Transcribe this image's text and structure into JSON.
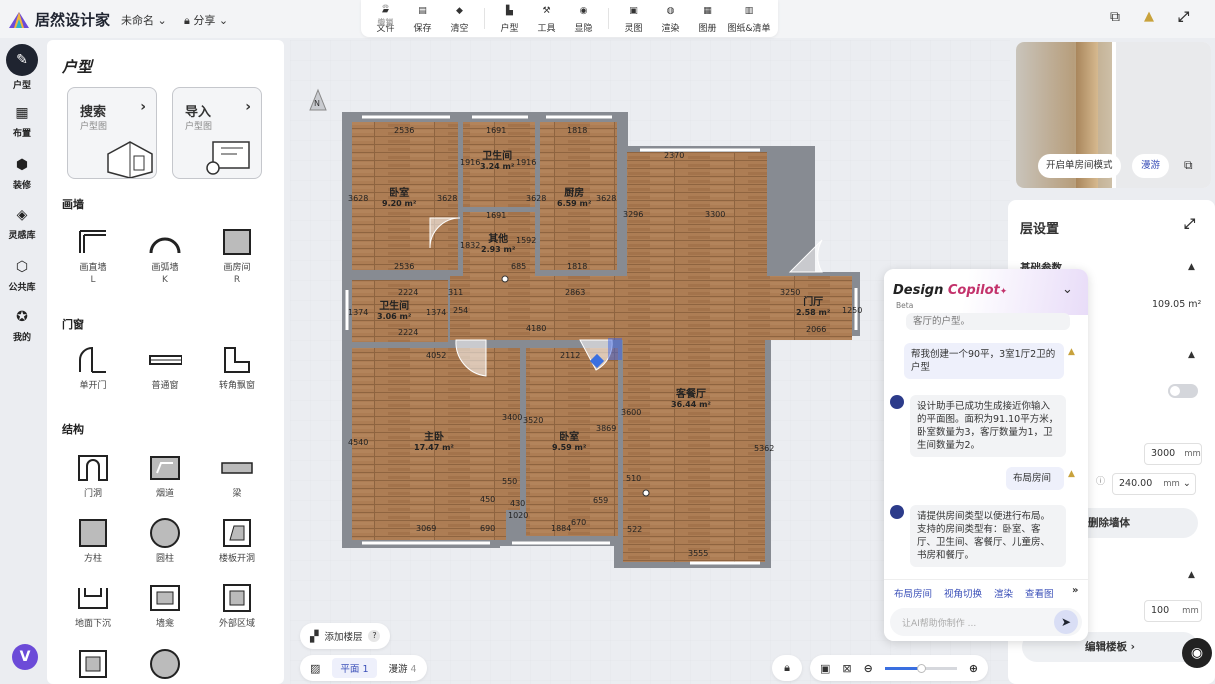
{
  "app": {
    "name": "居然设计家",
    "doc_name": "未命名",
    "share_label": "分享"
  },
  "toolbar": [
    {
      "label": "文件",
      "icon": "folder-icon",
      "dim": false
    },
    {
      "label": "保存",
      "icon": "save-icon",
      "dim": false
    },
    {
      "label": "撤销",
      "icon": "undo-icon",
      "dim": true
    },
    {
      "label": "恢复",
      "icon": "redo-icon",
      "dim": true
    },
    {
      "label": "清空",
      "icon": "eraser-icon",
      "dim": false
    },
    {
      "label": "户型",
      "icon": "floorplan-icon",
      "dim": false
    },
    {
      "label": "工具",
      "icon": "tools-icon",
      "dim": false
    },
    {
      "label": "显隐",
      "icon": "eye-icon",
      "dim": false
    },
    {
      "label": "灵图",
      "icon": "ai-image-icon",
      "dim": false
    },
    {
      "label": "渲染",
      "icon": "camera-icon",
      "dim": false
    },
    {
      "label": "图册",
      "icon": "album-icon",
      "dim": false
    },
    {
      "label": "图纸&清单",
      "icon": "drawings-icon",
      "dim": false
    }
  ],
  "rail": [
    {
      "label": "户型",
      "icon": "compass-icon",
      "active": true
    },
    {
      "label": "布置",
      "icon": "layout-icon",
      "active": false
    },
    {
      "label": "装修",
      "icon": "decor-cube-icon",
      "active": false
    },
    {
      "label": "灵感库",
      "icon": "inspiration-icon",
      "active": false
    },
    {
      "label": "公共库",
      "icon": "library-icon",
      "active": false
    },
    {
      "label": "我的",
      "icon": "star-icon",
      "active": false
    }
  ],
  "panel": {
    "title": "户型",
    "cards": [
      {
        "title": "搜索",
        "sub": "户型图"
      },
      {
        "title": "导入",
        "sub": "户型图"
      }
    ],
    "sections": {
      "draw_wall": "画墙",
      "doors": "门窗",
      "structure": "结构"
    },
    "wall_tools": [
      {
        "label": "画直墙",
        "key": "L"
      },
      {
        "label": "画弧墙",
        "key": "K"
      },
      {
        "label": "画房间",
        "key": "R"
      }
    ],
    "door_tools": [
      {
        "label": "单开门"
      },
      {
        "label": "普通窗"
      },
      {
        "label": "转角飘窗"
      }
    ],
    "struct_tools": [
      {
        "label": "门洞"
      },
      {
        "label": "烟道"
      },
      {
        "label": "梁"
      },
      {
        "label": "方柱"
      },
      {
        "label": "圆柱"
      },
      {
        "label": "楼板开洞"
      },
      {
        "label": "地面下沉"
      },
      {
        "label": "墙龛"
      },
      {
        "label": "外部区域"
      }
    ]
  },
  "rooms": [
    {
      "name": "卧室",
      "area": "9.20 m²"
    },
    {
      "name": "卫生间",
      "area": "3.24 m²"
    },
    {
      "name": "厨房",
      "area": "6.59 m²"
    },
    {
      "name": "其他",
      "area": "2.93 m²"
    },
    {
      "name": "卫生间",
      "area": "3.06 m²"
    },
    {
      "name": "门厅",
      "area": "2.58 m²"
    },
    {
      "name": "客餐厅",
      "area": "36.44 m²"
    },
    {
      "name": "主卧",
      "area": "17.47 m²"
    },
    {
      "name": "卧室",
      "area": "9.59 m²"
    }
  ],
  "dims": [
    "2536",
    "1691",
    "1818",
    "2370",
    "1916",
    "1916",
    "3628",
    "3628",
    "3628",
    "3628",
    "1691",
    "3296",
    "3300",
    "1832",
    "1592",
    "2536",
    "685",
    "1818",
    "2863",
    "3250",
    "1250",
    "2224",
    "311",
    "1374",
    "1374",
    "254",
    "2224",
    "2066",
    "4180",
    "4052",
    "2112",
    "3400",
    "3520",
    "3869",
    "3600",
    "4540",
    "5362",
    "550",
    "450",
    "430",
    "1020",
    "659",
    "510",
    "690",
    "3069",
    "1884",
    "670",
    "522",
    "3555"
  ],
  "canvas_controls": {
    "add_floor": "添加楼层",
    "plan_tab": "平面",
    "plan_count": "1",
    "tour_tab": "漫游",
    "tour_count": "4",
    "help": "?"
  },
  "preview": {
    "single_room_mode": "开启单房间模式",
    "tour": "漫游"
  },
  "settings": {
    "title": "层设置",
    "basic_params": "基础参数",
    "area_value": "109.05 m²",
    "height_value": "3000",
    "height_unit": "mm",
    "wall_value": "240.00",
    "wall_unit": "mm",
    "delete_wall": "删除墙体",
    "slab_value": "100",
    "slab_unit": "mm",
    "edit_slab": "编辑楼板 ›"
  },
  "copilot": {
    "title_a": "Design ",
    "title_b": "Copilot",
    "beta": "Beta",
    "messages": [
      {
        "role": "bot",
        "text": "客厅的户型。"
      },
      {
        "role": "user",
        "text": "帮我创建一个90平，3室1厅2卫的户型"
      },
      {
        "role": "bot",
        "text": "设计助手已成功生成接近你输入的平面图。面积为91.10平方米，卧室数量为3，客厅数量为1，卫生间数量为2。"
      },
      {
        "role": "user",
        "text": "布局房间"
      },
      {
        "role": "bot",
        "text": "请提供房间类型以便进行布局。支持的房间类型有：卧室、客厅、卫生间、客餐厅、儿童房、书房和餐厅。"
      }
    ],
    "quick_actions": [
      "布局房间",
      "视角切换",
      "渲染",
      "查看图"
    ],
    "input_placeholder": "让AI帮助你制作 ..."
  },
  "colors": {
    "accent": "#3a4fb8",
    "wall": "#878b92",
    "floor": "#a97a52",
    "rail_active": "#1f2430"
  }
}
